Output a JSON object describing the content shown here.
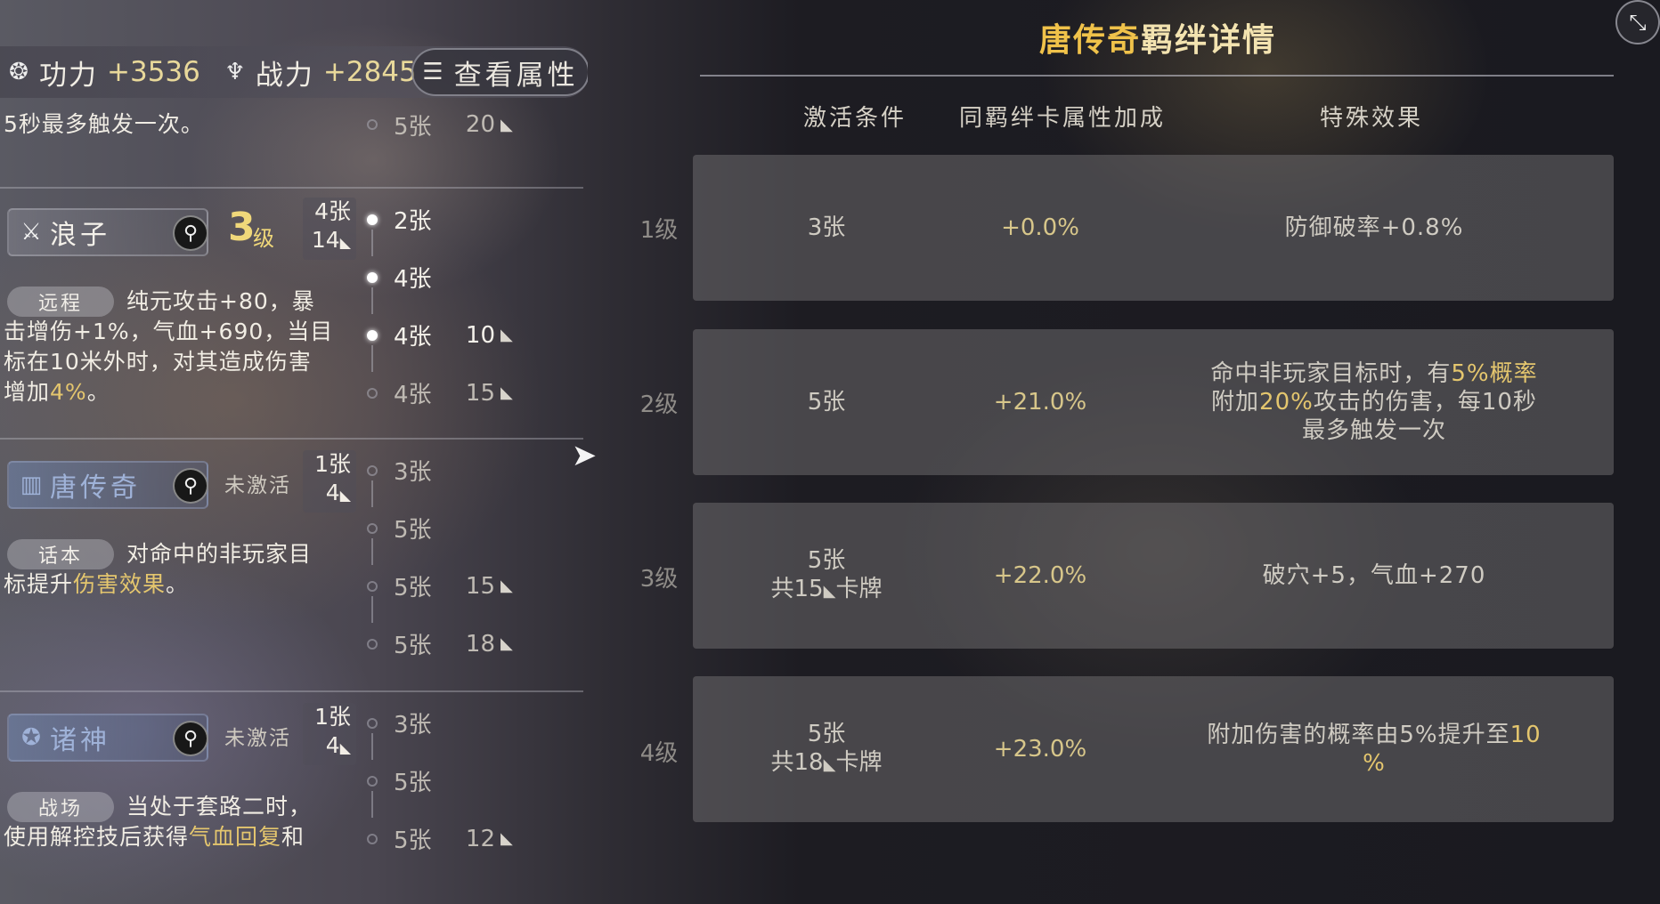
{
  "stats": {
    "power_label": "功力",
    "power_value": "+3536",
    "combat_label": "战力",
    "combat_value": "+2845",
    "view_attr_label": "查看属性",
    "power_icon": "swirl-icon",
    "combat_icon": "tree-emblem-icon",
    "view_attr_icon": "list-icon"
  },
  "previous_bond": {
    "desc_line": "5秒最多触发一次。",
    "tier": {
      "count": "5张",
      "need": "20"
    }
  },
  "bonds": [
    {
      "name": "浪子",
      "icon": "sword-icon",
      "level": "3",
      "level_suffix": "级",
      "count_current": "4张",
      "count_cards": "14",
      "tag": "远程",
      "desc_lines": [
        "纯元攻击+80，暴",
        "击增伤+1%，气血+690，当目",
        "标在10米外时，对其造成伤害",
        "增加"
      ],
      "desc_highlight": "4%",
      "desc_end": "。",
      "tiers": [
        {
          "count": "2张",
          "need": "",
          "active": true
        },
        {
          "count": "4张",
          "need": "",
          "active": true
        },
        {
          "count": "4张",
          "need": "10",
          "active": true
        },
        {
          "count": "4张",
          "need": "15",
          "active": false
        }
      ]
    },
    {
      "name": "唐传奇",
      "icon": "book-icon",
      "status": "未激活",
      "count_current": "1张",
      "count_cards": "4",
      "tag": "话本",
      "desc_line1": "对命中的非玩家目",
      "desc_line2_pre": "标提升",
      "desc_highlight": "伤害效果",
      "desc_end": "。",
      "tiers": [
        {
          "count": "3张",
          "need": "",
          "active": false
        },
        {
          "count": "5张",
          "need": "",
          "active": false
        },
        {
          "count": "5张",
          "need": "15",
          "active": false
        },
        {
          "count": "5张",
          "need": "18",
          "active": false
        }
      ]
    },
    {
      "name": "诸神",
      "icon": "deity-icon",
      "status": "未激活",
      "count_current": "1张",
      "count_cards": "4",
      "tag": "战场",
      "desc_line1": "当处于套路二时，",
      "desc_line2_pre": "使用解控技后获得",
      "desc_highlight": "气血回复",
      "desc_end": "和",
      "tiers": [
        {
          "count": "3张",
          "need": "",
          "active": false
        },
        {
          "count": "5张",
          "need": "",
          "active": false
        },
        {
          "count": "5张",
          "need": "12",
          "active": false
        }
      ]
    }
  ],
  "detail": {
    "title_accent": "唐传奇",
    "title_rest": "羁绊详情",
    "columns": [
      "激活条件",
      "同羁绊卡属性加成",
      "特殊效果"
    ],
    "levels": [
      {
        "label": "1级",
        "cond_line1": "3张",
        "cond_line2": "",
        "bonus": "+0.0%",
        "effect_html": "防御破率+0.8%"
      },
      {
        "label": "2级",
        "cond_line1": "5张",
        "cond_line2": "",
        "bonus": "+21.0%",
        "effect_l1_pre": "命中非玩家目标时，有",
        "effect_l1_hl": "5%概率",
        "effect_l2_pre": "附加",
        "effect_l2_hl": "20%",
        "effect_l2_post": "攻击的伤害，每10秒",
        "effect_l3": "最多触发一次"
      },
      {
        "label": "3级",
        "cond_line1": "5张",
        "cond_line2_pre": "共15",
        "cond_line2_post": "卡牌",
        "bonus": "+22.0%",
        "effect_html": "破穴+5，气血+270"
      },
      {
        "label": "4级",
        "cond_line1": "5张",
        "cond_line2_pre": "共18",
        "cond_line2_post": "卡牌",
        "bonus": "+23.0%",
        "effect_l1_pre": "附加伤害的概率由5%提升至",
        "effect_l1_hl": "10",
        "effect_l2_hl": "%"
      }
    ]
  },
  "colors": {
    "highlight": "#e4c66e",
    "title_accent": "#f0c24a",
    "inactive_name": "#9fb2d8"
  }
}
